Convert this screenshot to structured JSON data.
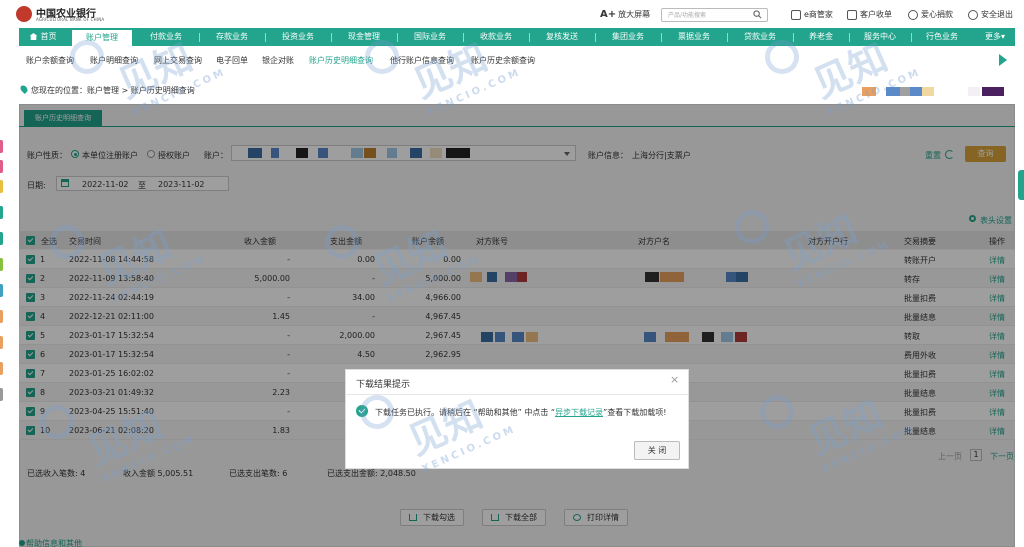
{
  "brand": {
    "name_cn": "中国农业银行",
    "name_en": "AGRICULTURAL BANK OF CHINA",
    "color": "#23a48d"
  },
  "header": {
    "big_screen": "放大屏幕",
    "big_screen_mark": "A+",
    "search_placeholder": "产品/功能搜索",
    "links": [
      "e商管家",
      "客户收单",
      "爱心捐款",
      "安全退出"
    ]
  },
  "nav": {
    "home": "首页",
    "items": [
      "账户管理",
      "付款业务",
      "存款业务",
      "投资业务",
      "现金管理",
      "国际业务",
      "收款业务",
      "复核发送",
      "集团业务",
      "票据业务",
      "贷款业务",
      "养老金",
      "服务中心",
      "行色业务"
    ],
    "active_index": 0,
    "more": "更多▾"
  },
  "subnav": {
    "items": [
      "账户余额查询",
      "账户明细查询",
      "网上交易查询",
      "电子回单",
      "银企对账",
      "账户历史明细查询",
      "他行账户信息查询",
      "账户历史余额查询"
    ],
    "active_index": 5
  },
  "breadcrumb": "您现在的位置：账户管理 > 账户历史明细查询",
  "tab": "账户历史明细查询",
  "filters": {
    "acct_type_label": "账户性质：",
    "opt1": "本单位注册账户",
    "opt2": "授权账户",
    "acct_label": "账户：",
    "acct_info_label": "账户信息：",
    "acct_info_value": "上海分行|支票户",
    "reset": "重置",
    "query": "查询",
    "date_label": "日期:",
    "date_from": "2022-11-02",
    "date_sep": "至",
    "date_to": "2023-11-02"
  },
  "table": {
    "settings": "表头设置",
    "headers": [
      "全选",
      "交易时间",
      "收入金额",
      "支出金额",
      "账户余额",
      "对方账号",
      "对方户名",
      "对方开户行",
      "交易摘要",
      "操作"
    ],
    "rows": [
      {
        "no": "1",
        "time": "2022-11-08 14:44:58",
        "income": "-",
        "expense": "0.00",
        "balance": "0.00",
        "summary": "转账开户",
        "op": "详情"
      },
      {
        "no": "2",
        "time": "2022-11-09 13:58:40",
        "income": "5,000.00",
        "expense": "-",
        "balance": "5,000.00",
        "summary": "转存",
        "op": "详情"
      },
      {
        "no": "3",
        "time": "2022-11-24 02:44:19",
        "income": "-",
        "expense": "34.00",
        "balance": "4,966.00",
        "summary": "批量扣费",
        "op": "详情"
      },
      {
        "no": "4",
        "time": "2022-12-21 02:11:00",
        "income": "1.45",
        "expense": "-",
        "balance": "4,967.45",
        "summary": "批量结息",
        "op": "详情"
      },
      {
        "no": "5",
        "time": "2023-01-17 15:32:54",
        "income": "-",
        "expense": "2,000.00",
        "balance": "2,967.45",
        "summary": "转取",
        "op": "详情"
      },
      {
        "no": "6",
        "time": "2023-01-17 15:32:54",
        "income": "-",
        "expense": "4.50",
        "balance": "2,962.95",
        "summary": "费用外收",
        "op": "详情"
      },
      {
        "no": "7",
        "time": "2023-01-25 16:02:02",
        "income": "-",
        "expense": "",
        "balance": "",
        "summary": "批量扣费",
        "op": "详情"
      },
      {
        "no": "8",
        "time": "2023-03-21 01:49:32",
        "income": "2.23",
        "expense": "",
        "balance": "",
        "summary": "批量结息",
        "op": "详情"
      },
      {
        "no": "9",
        "time": "2023-04-25 15:51:40",
        "income": "-",
        "expense": "",
        "balance": "",
        "summary": "批量扣费",
        "op": "详情"
      },
      {
        "no": "10",
        "time": "2023-06-21 02:08:20",
        "income": "1.83",
        "expense": "",
        "balance": "",
        "summary": "批量结息",
        "op": "详情"
      }
    ]
  },
  "summary": {
    "income_count": "已选收入笔数: 4",
    "income_amount": "收入金额 5,005.51",
    "expense_count": "已选支出笔数: 6",
    "expense_amount": "已选支出金额: 2,048.50"
  },
  "pager": {
    "prev": "上一页",
    "page": "1",
    "next": "下一页"
  },
  "buttons": [
    "下载勾选",
    "下载全部",
    "打印详情"
  ],
  "help": "帮助信息和其他",
  "dialog": {
    "title": "下载结果提示",
    "close": "×",
    "msg_before": "下载任务已执行。请稍后在 “帮助和其他” 中点击 “",
    "msg_link": "异步下载记录",
    "msg_after": "”查看下载加载项!",
    "ok": "关 闭"
  },
  "watermark": {
    "big": "见知",
    "small": "XENCIO.COM"
  },
  "colors": {
    "accent": "#23a48d",
    "query_button": "#d9a23a",
    "masks": [
      "#3a6ea5",
      "#e8a060",
      "#222222",
      "#8a6aa8",
      "#b13a3a",
      "#f0c080",
      "#5a8ac8",
      "#a0c8e8",
      "#4a2060"
    ]
  }
}
